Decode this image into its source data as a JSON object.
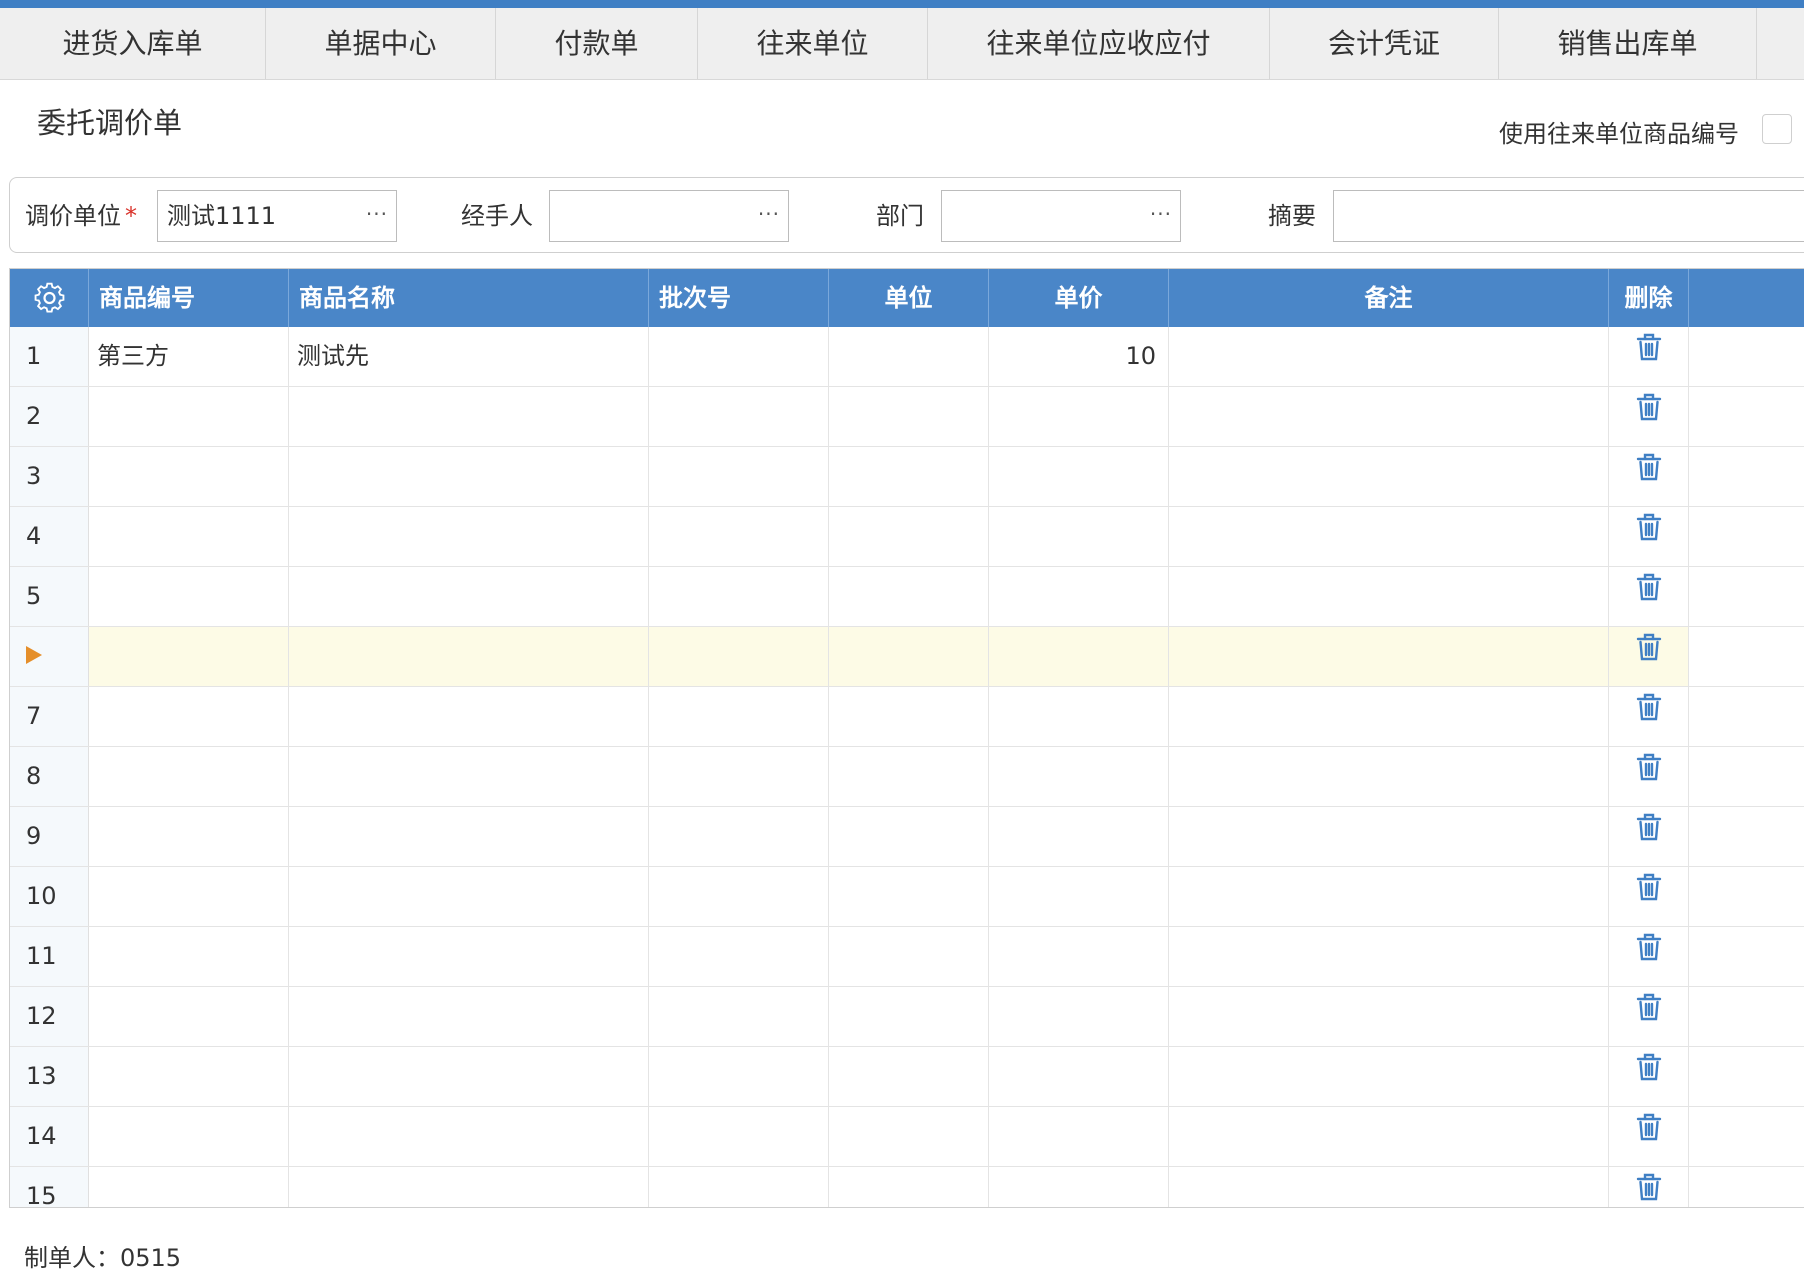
{
  "tabs": [
    {
      "label": "进货入库单"
    },
    {
      "label": "单据中心"
    },
    {
      "label": "付款单"
    },
    {
      "label": "往来单位"
    },
    {
      "label": "往来单位应收应付"
    },
    {
      "label": "会计凭证"
    },
    {
      "label": "销售出库单"
    }
  ],
  "page": {
    "title": "委托调价单",
    "use_code_label": "使用往来单位商品编号"
  },
  "form": {
    "unit_label": "调价单位",
    "required_mark": "*",
    "unit_value": "测试1111",
    "handler_label": "经手人",
    "handler_value": "",
    "dept_label": "部门",
    "dept_value": "",
    "summary_label": "摘要",
    "summary_value": "",
    "ellipsis": "···"
  },
  "grid": {
    "columns": [
      "商品编号",
      "商品名称",
      "批次号",
      "单位",
      "单价",
      "备注",
      "删除"
    ],
    "rows": [
      {
        "no": "1",
        "code": "第三方",
        "name": "测试先",
        "batch": "",
        "unit": "",
        "price": "10",
        "note": ""
      },
      {
        "no": "2",
        "code": "",
        "name": "",
        "batch": "",
        "unit": "",
        "price": "",
        "note": ""
      },
      {
        "no": "3",
        "code": "",
        "name": "",
        "batch": "",
        "unit": "",
        "price": "",
        "note": ""
      },
      {
        "no": "4",
        "code": "",
        "name": "",
        "batch": "",
        "unit": "",
        "price": "",
        "note": ""
      },
      {
        "no": "5",
        "code": "",
        "name": "",
        "batch": "",
        "unit": "",
        "price": "",
        "note": ""
      },
      {
        "no": "",
        "code": "",
        "name": "",
        "batch": "",
        "unit": "",
        "price": "",
        "note": "",
        "active": true
      },
      {
        "no": "7",
        "code": "",
        "name": "",
        "batch": "",
        "unit": "",
        "price": "",
        "note": ""
      },
      {
        "no": "8",
        "code": "",
        "name": "",
        "batch": "",
        "unit": "",
        "price": "",
        "note": ""
      },
      {
        "no": "9",
        "code": "",
        "name": "",
        "batch": "",
        "unit": "",
        "price": "",
        "note": ""
      },
      {
        "no": "10",
        "code": "",
        "name": "",
        "batch": "",
        "unit": "",
        "price": "",
        "note": ""
      },
      {
        "no": "11",
        "code": "",
        "name": "",
        "batch": "",
        "unit": "",
        "price": "",
        "note": ""
      },
      {
        "no": "12",
        "code": "",
        "name": "",
        "batch": "",
        "unit": "",
        "price": "",
        "note": ""
      },
      {
        "no": "13",
        "code": "",
        "name": "",
        "batch": "",
        "unit": "",
        "price": "",
        "note": ""
      },
      {
        "no": "14",
        "code": "",
        "name": "",
        "batch": "",
        "unit": "",
        "price": "",
        "note": ""
      },
      {
        "no": "15",
        "code": "",
        "name": "",
        "batch": "",
        "unit": "",
        "price": "",
        "note": ""
      }
    ]
  },
  "footer": {
    "creator_label": "制单人：",
    "creator_value": "0515"
  },
  "colors": {
    "accent": "#3f7fc4",
    "header_bg": "#4a86c8",
    "active_row_bg": "#fdfbe6",
    "required": "#d9322a",
    "trash_icon": "#3f7fc4",
    "row_arrow": "#e58f2a"
  },
  "icons": {
    "settings": "gear-icon",
    "delete": "trash-icon",
    "current_row": "triangle-right-icon",
    "picker": "ellipsis-icon"
  }
}
